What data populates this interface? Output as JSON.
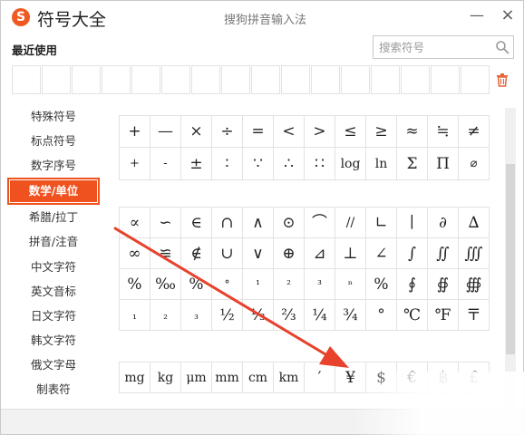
{
  "app": {
    "logo_glyph": "S",
    "title": "符号大全",
    "subtitle": "搜狗拼音输入法",
    "minimize_glyph": "—",
    "close_glyph": "×"
  },
  "recent": {
    "label": "最近使用"
  },
  "search": {
    "placeholder": "搜索符号",
    "value": ""
  },
  "sidebar": {
    "categories": [
      {
        "label": "特殊符号"
      },
      {
        "label": "标点符号"
      },
      {
        "label": "数字序号"
      },
      {
        "label": "数学/单位",
        "active": true
      },
      {
        "label": "希腊/拉丁"
      },
      {
        "label": "拼音/注音"
      },
      {
        "label": "中文字符"
      },
      {
        "label": "英文音标"
      },
      {
        "label": "日文字符"
      },
      {
        "label": "韩文字符"
      },
      {
        "label": "俄文字母"
      },
      {
        "label": "制表符"
      }
    ]
  },
  "symbols": {
    "row_a1": [
      "+",
      "—",
      "×",
      "÷",
      "=",
      "<",
      ">",
      "≤",
      "≥",
      "≈",
      "≒",
      "≠"
    ],
    "row_a2": [
      "+",
      "-",
      "±",
      "∶",
      "∵",
      "∴",
      "∷",
      "log",
      "ln",
      "Σ",
      "Π",
      "⌀"
    ],
    "row_b1": [
      "∝",
      "∽",
      "∈",
      "∩",
      "∧",
      "⊙",
      "⌒",
      "//",
      "∟",
      "∣",
      "∂",
      "∆"
    ],
    "row_b2": [
      "∞",
      "≌",
      "∉",
      "∪",
      "∨",
      "⊕",
      "⊿",
      "⊥",
      "∠",
      "∫",
      "∬",
      "∭"
    ],
    "row_b3": [
      "%",
      "‰",
      "%",
      "°",
      "¹",
      "²",
      "³",
      "ⁿ",
      "%",
      "∮",
      "∯",
      "∰"
    ],
    "row_b4": [
      "₁",
      "₂",
      "₃",
      "½",
      "⅓",
      "⅔",
      "¼",
      "¾",
      "°",
      "℃",
      "℉",
      "〒"
    ],
    "row_c1": [
      "mg",
      "kg",
      "μm",
      "mm",
      "cm",
      "km",
      "′",
      "¥",
      "$",
      "€",
      "฿",
      "£"
    ]
  },
  "colors": {
    "accent": "#f0521f",
    "arrow": "#e8412c"
  }
}
